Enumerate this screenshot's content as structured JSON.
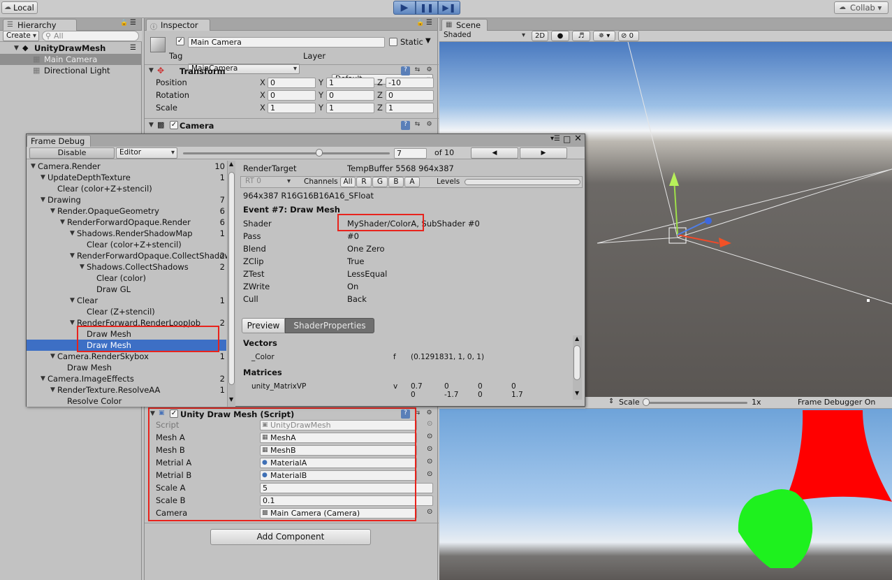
{
  "toolbar": {
    "account": "Local",
    "collab": "Collab"
  },
  "hierarchy": {
    "tab": "Hierarchy",
    "create": "Create",
    "search_placeholder": "All",
    "scene": "UnityDrawMesh",
    "items": [
      "Main Camera",
      "Directional Light"
    ]
  },
  "inspector": {
    "tab": "Inspector",
    "object_name": "Main Camera",
    "static_label": "Static",
    "tag_label": "Tag",
    "tag_value": "MainCamera",
    "layer_label": "Layer",
    "layer_value": "Default",
    "transform": {
      "title": "Transform",
      "rows": [
        {
          "label": "Position",
          "x": "0",
          "y": "1",
          "z": "-10"
        },
        {
          "label": "Rotation",
          "x": "0",
          "y": "0",
          "z": "0"
        },
        {
          "label": "Scale",
          "x": "1",
          "y": "1",
          "z": "1"
        }
      ]
    },
    "camera_title": "Camera",
    "script_title": "Unity Draw Mesh (Script)",
    "script_fields": [
      {
        "label": "Script",
        "value": "UnityDrawMesh"
      },
      {
        "label": "Mesh A",
        "value": "MeshA"
      },
      {
        "label": "Mesh B",
        "value": "MeshB"
      },
      {
        "label": "Metrial A",
        "value": "MaterialA"
      },
      {
        "label": "Metrial B",
        "value": "MaterialB"
      },
      {
        "label": "Scale A",
        "value": "5"
      },
      {
        "label": "Scale B",
        "value": "0.1"
      },
      {
        "label": "Camera",
        "value": "Main Camera (Camera)"
      }
    ],
    "add_component": "Add Component",
    "axis": {
      "x": "X",
      "y": "Y",
      "z": "Z"
    }
  },
  "scene": {
    "tab": "Scene",
    "shading": "Shaded",
    "mode2d": "2D",
    "gizmo_count": "0"
  },
  "game": {
    "scale_label": "Scale",
    "scale_value": "1x",
    "status": "Frame Debugger On"
  },
  "frame_debug": {
    "title": "Frame Debug",
    "disable": "Disable",
    "editor": "Editor",
    "current": "7",
    "total": "of 10",
    "tree": [
      {
        "label": "Camera.Render",
        "count": "10",
        "depth": 0,
        "arrow": true
      },
      {
        "label": "UpdateDepthTexture",
        "count": "1",
        "depth": 1,
        "arrow": true
      },
      {
        "label": "Clear (color+Z+stencil)",
        "count": "",
        "depth": 2,
        "arrow": false
      },
      {
        "label": "Drawing",
        "count": "7",
        "depth": 1,
        "arrow": true
      },
      {
        "label": "Render.OpaqueGeometry",
        "count": "6",
        "depth": 2,
        "arrow": true
      },
      {
        "label": "RenderForwardOpaque.Render",
        "count": "6",
        "depth": 3,
        "arrow": true
      },
      {
        "label": "Shadows.RenderShadowMap",
        "count": "1",
        "depth": 4,
        "arrow": true
      },
      {
        "label": "Clear (color+Z+stencil)",
        "count": "",
        "depth": 5,
        "arrow": false
      },
      {
        "label": "RenderForwardOpaque.CollectShadows",
        "count": "2",
        "depth": 4,
        "arrow": true
      },
      {
        "label": "Shadows.CollectShadows",
        "count": "2",
        "depth": 5,
        "arrow": true
      },
      {
        "label": "Clear (color)",
        "count": "",
        "depth": 6,
        "arrow": false
      },
      {
        "label": "Draw GL",
        "count": "",
        "depth": 6,
        "arrow": false
      },
      {
        "label": "Clear",
        "count": "1",
        "depth": 4,
        "arrow": true
      },
      {
        "label": "Clear (Z+stencil)",
        "count": "",
        "depth": 5,
        "arrow": false
      },
      {
        "label": "RenderForward.RenderLoopJob",
        "count": "2",
        "depth": 4,
        "arrow": true
      },
      {
        "label": "Draw Mesh",
        "count": "",
        "depth": 5,
        "arrow": false
      },
      {
        "label": "Draw Mesh",
        "count": "",
        "depth": 5,
        "arrow": false,
        "selected": true
      },
      {
        "label": "Camera.RenderSkybox",
        "count": "1",
        "depth": 2,
        "arrow": true
      },
      {
        "label": "Draw Mesh",
        "count": "",
        "depth": 3,
        "arrow": false
      },
      {
        "label": "Camera.ImageEffects",
        "count": "2",
        "depth": 1,
        "arrow": true
      },
      {
        "label": "RenderTexture.ResolveAA",
        "count": "1",
        "depth": 2,
        "arrow": true
      },
      {
        "label": "Resolve Color",
        "count": "",
        "depth": 3,
        "arrow": false
      }
    ],
    "render_target_label": "RenderTarget",
    "render_target_value": "TempBuffer 5568 964x387",
    "rt_drop": "RT 0",
    "channels": "Channels",
    "channel_btns": [
      "All",
      "R",
      "G",
      "B",
      "A"
    ],
    "levels": "Levels",
    "format": "964x387 R16G16B16A16_SFloat",
    "event_title": "Event #7: Draw Mesh",
    "props": [
      {
        "label": "Shader",
        "value": "MyShader/ColorA, SubShader #0"
      },
      {
        "label": "Pass",
        "value": "#0"
      },
      {
        "label": "Blend",
        "value": "One Zero"
      },
      {
        "label": "ZClip",
        "value": "True"
      },
      {
        "label": "ZTest",
        "value": "LessEqual"
      },
      {
        "label": "ZWrite",
        "value": "On"
      },
      {
        "label": "Cull",
        "value": "Back"
      }
    ],
    "tab_preview": "Preview",
    "tab_props": "ShaderProperties",
    "vectors_title": "Vectors",
    "color_name": "_Color",
    "color_type": "f",
    "color_value": "(0.1291831, 1, 0, 1)",
    "matrices_title": "Matrices",
    "matrix_name": "unity_MatrixVP",
    "matrix_type": "v",
    "matrix_row1": [
      "0.7",
      "0",
      "0",
      "0"
    ],
    "matrix_row2": [
      "0",
      "-1.7",
      "0",
      "1.7"
    ]
  },
  "colors": {
    "selection": "#3d6fc5",
    "highlight": "#e8231c",
    "play_blue": "#5e86c0",
    "mesh_green": "#1ef11e",
    "mesh_red": "#ff0000"
  }
}
